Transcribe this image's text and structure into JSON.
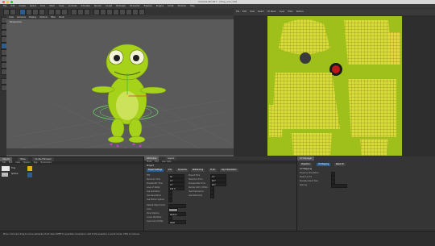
{
  "window": {
    "title": "Cinema 4D R17 - [frog_uvs.c4d]",
    "dots": [
      "#ff5f57",
      "#febc2e",
      "#28c840"
    ]
  },
  "menu": [
    "File",
    "Edit",
    "Create",
    "Select",
    "Tools",
    "Mesh",
    "Snap",
    "Animate",
    "Simulate",
    "Render",
    "Sculpt",
    "MoGraph",
    "Character",
    "Pipeline",
    "Plugins",
    "Script",
    "Window",
    "Help"
  ],
  "viewport": {
    "header": [
      "View",
      "Cameras",
      "Display",
      "Options",
      "Filter",
      "Panel"
    ],
    "label": "Perspective"
  },
  "uv_editor": {
    "header": [
      "File",
      "Edit",
      "View",
      "Select",
      "UV Mesh",
      "Layer",
      "Filter",
      "Texture"
    ],
    "status": "Size : 1024x1024, RGB (8 Bit), frog_uvs.tif"
  },
  "objects": {
    "tabs": [
      "Objects",
      "Takes",
      "Content Browser"
    ],
    "header": [
      "File",
      "Edit",
      "View",
      "Objects",
      "Tags",
      "Bookmarks"
    ],
    "items": [
      "Frog",
      "Sphere"
    ]
  },
  "attributes": {
    "tabs": [
      "Attributes",
      "Layers"
    ],
    "header": [
      "Mode",
      "Edit",
      "User Data"
    ],
    "title": "Project",
    "subtabs": [
      "Project Settings",
      "Info",
      "Dynamics",
      "Referencing",
      "To Do",
      "Key Interpolation"
    ],
    "left_fields": [
      {
        "label": "FPS",
        "value": "30"
      },
      {
        "label": "Minimum Time",
        "value": "0 F"
      },
      {
        "label": "Preview Min Time",
        "value": "0 F"
      },
      {
        "label": "Level of Detail",
        "value": "100 %"
      },
      {
        "label": "Use Animation",
        "value": ""
      },
      {
        "label": "Use Generators",
        "value": ""
      },
      {
        "label": "Use Motion System",
        "value": ""
      }
    ],
    "right_fields": [
      {
        "label": "Project Time",
        "value": "0 F"
      },
      {
        "label": "Maximum Time",
        "value": "90 F"
      },
      {
        "label": "Preview Max Time",
        "value": "90 F"
      },
      {
        "label": "Render LOD in Editor",
        "value": ""
      },
      {
        "label": "Use Expressions",
        "value": ""
      },
      {
        "label": "Use Deformers",
        "value": ""
      }
    ],
    "lower_fields": [
      "Default Object Color",
      "Color",
      "View Clipping",
      "Linear Workflow",
      "Input Color Profile"
    ],
    "color_value": "Medium",
    "profile_value": "sRGB"
  },
  "right_panel": {
    "tabs": [
      "UV Manager"
    ],
    "subtabs": [
      "Projection",
      "UV Mapping",
      "Relax UV"
    ],
    "title": "UV Mapping",
    "fields": [
      "Preserve Orientation",
      "Stretch to Fit",
      "Equalize Island Size",
      "Spacing"
    ]
  },
  "status": {
    "text": "Move: Click and drag to move elements. Hold down SHIFT to quantize movement / add to the selection in point mode, CTRL to remove."
  },
  "colors": {
    "frog_body": "#a6d21a",
    "frog_dark": "#6e9012",
    "uv_bg": "#9fbf1a",
    "uv_shell": "#d8dc34"
  }
}
